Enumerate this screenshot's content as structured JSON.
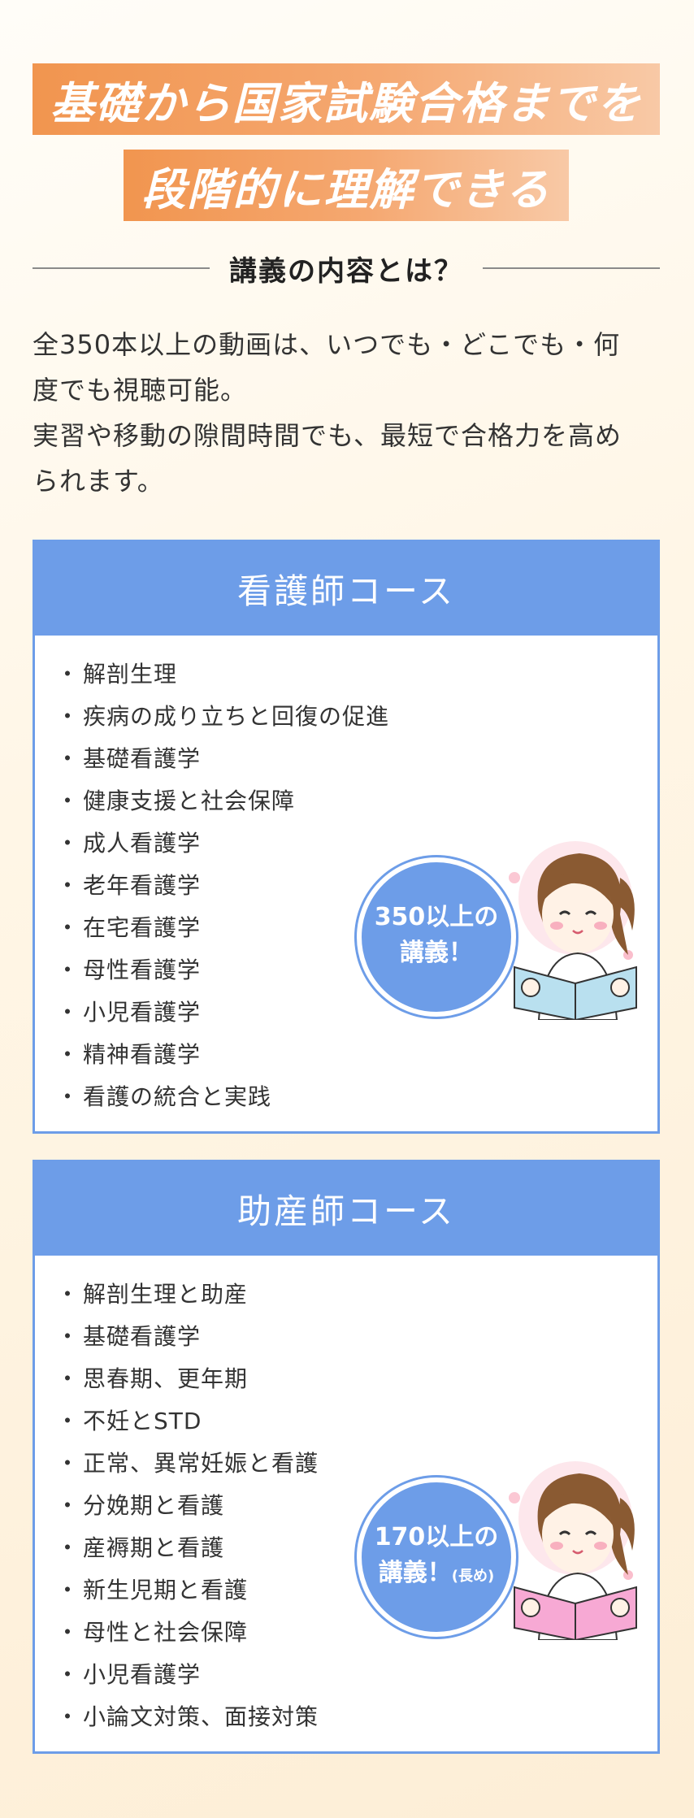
{
  "hero": {
    "line1": "基礎から国家試験合格までを",
    "line2": "段階的に理解できる"
  },
  "section": {
    "title": "講義の内容とは？"
  },
  "intro": {
    "line1": "全350本以上の動画は、いつでも・どこでも・何",
    "line2": "度でも視聴可能。",
    "line3": "実習や移動の隙間時間でも、最短で合格力を高め",
    "line4": "られます。"
  },
  "courses": [
    {
      "title": "看護師コース",
      "badge_line1": "350以上の",
      "badge_line2": "講義！",
      "badge_note": "",
      "book_color": "#b9e0ef",
      "items": [
        "解剖生理",
        "疾病の成り立ちと回復の促進",
        "基礎看護学",
        "健康支援と社会保障",
        "成人看護学",
        "老年看護学",
        "在宅看護学",
        "母性看護学",
        "小児看護学",
        "精神看護学",
        "看護の統合と実践"
      ]
    },
    {
      "title": "助産師コース",
      "badge_line1": "170以上の",
      "badge_line2": "講義！",
      "badge_note": "(長め)",
      "book_color": "#f7a9d4",
      "items": [
        "解剖生理と助産",
        "基礎看護学",
        "思春期、更年期",
        "不妊とSTD",
        "正常、異常妊娠と看護",
        "分娩期と看護",
        "産褥期と看護",
        "新生児期と看護",
        "母性と社会保障",
        "小児看護学",
        "小論文対策、面接対策"
      ]
    }
  ],
  "colors": {
    "accent_blue": "#6d9de8",
    "hero_orange": "#f1954f"
  },
  "bullet": "・"
}
